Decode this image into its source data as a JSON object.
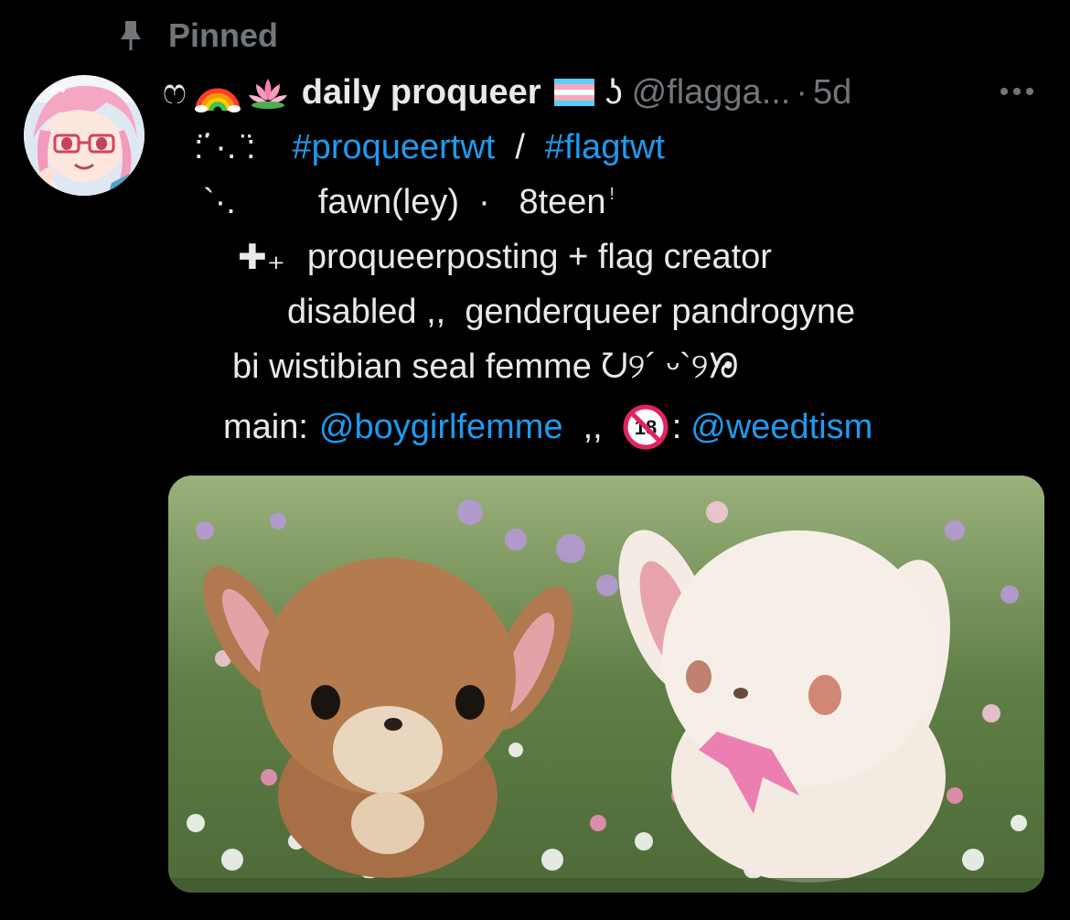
{
  "pinned": {
    "label": "Pinned",
    "icon": "pin-icon"
  },
  "tweet": {
    "avatar_icon": "anime-girl-avatar",
    "header": {
      "deco_open": "ෆ",
      "rainbow_icon": "rainbow-icon",
      "lotus_icon": "lotus-icon",
      "display_name": "daily proqueer",
      "flag_icon": "trans-flag-icon",
      "deco_close": "ʖ",
      "handle": "@flagga...",
      "separator": "·",
      "timestamp": "5d"
    },
    "more_icon": "ellipsis-icon",
    "bio": {
      "line1_deco": ":̈˙·. ̈:",
      "hashtag1": "#proqueertwt",
      "slash": "/",
      "hashtag2": "#flagtwt",
      "line2_deco": "`·.",
      "line2_text": "fawn(ley)  ·   8teen",
      "line2_mark": "!",
      "line3_deco": "✚₊",
      "line3_text": "proqueerposting + flag creator",
      "line4_text": "disabled ,,  genderqueer pandrogyne",
      "line5_text": "bi wistibian seal femme ᘢ୨´ ᵕ`୨ᘠ",
      "line6_prefix": "main:",
      "main_link": "@boygirlfemme",
      "line6_mid": ",,",
      "nsfw_icon": "18-plus-icon",
      "colon": ":",
      "alt_link": "@weedtism"
    },
    "media_icon": "plush-bunnies-photo"
  },
  "colors": {
    "background": "#000000",
    "text": "#e7e9ea",
    "muted": "#71767b",
    "link": "#1d9bf0"
  }
}
